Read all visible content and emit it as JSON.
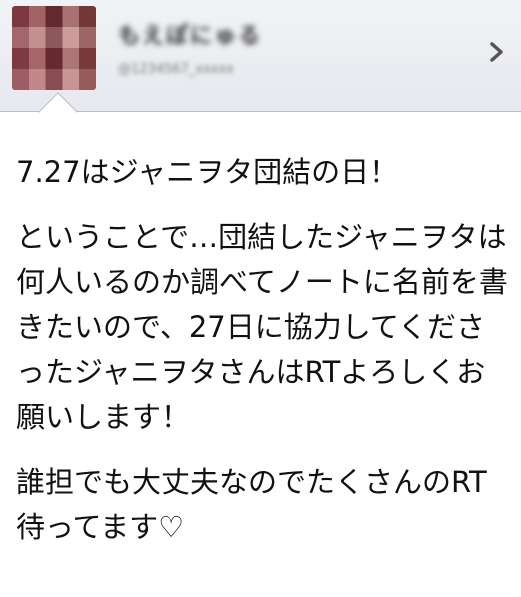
{
  "author": {
    "display_name": "もえぽにゅる",
    "handle": "@1234567_xxxxx"
  },
  "icons": {
    "chevron": "chevron-right-icon",
    "avatar": "avatar-image"
  },
  "tweet": {
    "paragraph_1": "7.27はジャニヲタ団結の日！",
    "paragraph_2": "ということで…団結したジャニヲタは何人いるのか調べてノートに名前を書きたいので、27日に協力してくださったジャニヲタさんはRTよろしくお願いします！",
    "paragraph_3": "誰担でも大丈夫なのでたくさんのRT待ってます♡"
  }
}
